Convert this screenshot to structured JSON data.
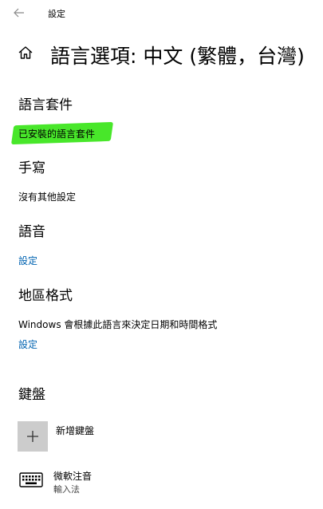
{
  "window": {
    "title": "設定"
  },
  "header": {
    "title": "語言選項: 中文 (繁體，台灣)"
  },
  "language_pack": {
    "heading": "語言套件",
    "status": "已安裝的語言套件"
  },
  "handwriting": {
    "heading": "手寫",
    "status": "沒有其他設定"
  },
  "speech": {
    "heading": "語音",
    "link": "設定"
  },
  "region_format": {
    "heading": "地區格式",
    "description": "Windows 會根據此語言來決定日期和時間格式",
    "link": "設定"
  },
  "keyboards": {
    "heading": "鍵盤",
    "add_label": "新增鍵盤",
    "items": [
      {
        "name": "微軟注音",
        "subtitle": "輸入法"
      }
    ]
  },
  "icons": {
    "back": "back-arrow-icon",
    "home": "home-icon",
    "add": "plus-icon",
    "keyboard": "keyboard-icon"
  },
  "colors": {
    "link": "#0063b1",
    "highlight": "#3ee61f",
    "tile": "#cccccc"
  }
}
